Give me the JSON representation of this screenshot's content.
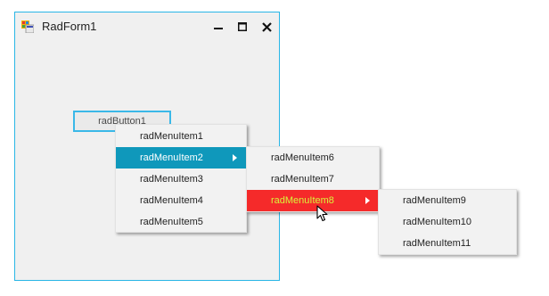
{
  "window": {
    "title": "RadForm1",
    "controls": {
      "minimize_icon": "minimize-icon",
      "maximize_icon": "maximize-icon",
      "close_icon": "close-icon"
    },
    "border_color": "#29b6e6"
  },
  "button": {
    "label": "radButton1"
  },
  "menu_level1": {
    "items": [
      {
        "label": "radMenuItem1"
      },
      {
        "label": "radMenuItem2",
        "has_submenu": true,
        "highlighted": true
      },
      {
        "label": "radMenuItem3"
      },
      {
        "label": "radMenuItem4"
      },
      {
        "label": "radMenuItem5"
      }
    ],
    "highlight_color": "#0f98bb"
  },
  "menu_level2": {
    "items": [
      {
        "label": "radMenuItem6"
      },
      {
        "label": "radMenuItem7"
      },
      {
        "label": "radMenuItem8",
        "has_submenu": true,
        "highlighted": true
      }
    ],
    "highlight_color": "#f52a2a",
    "highlight_text_color": "#d8f43a"
  },
  "menu_level3": {
    "items": [
      {
        "label": "radMenuItem9"
      },
      {
        "label": "radMenuItem10"
      },
      {
        "label": "radMenuItem11"
      }
    ]
  }
}
